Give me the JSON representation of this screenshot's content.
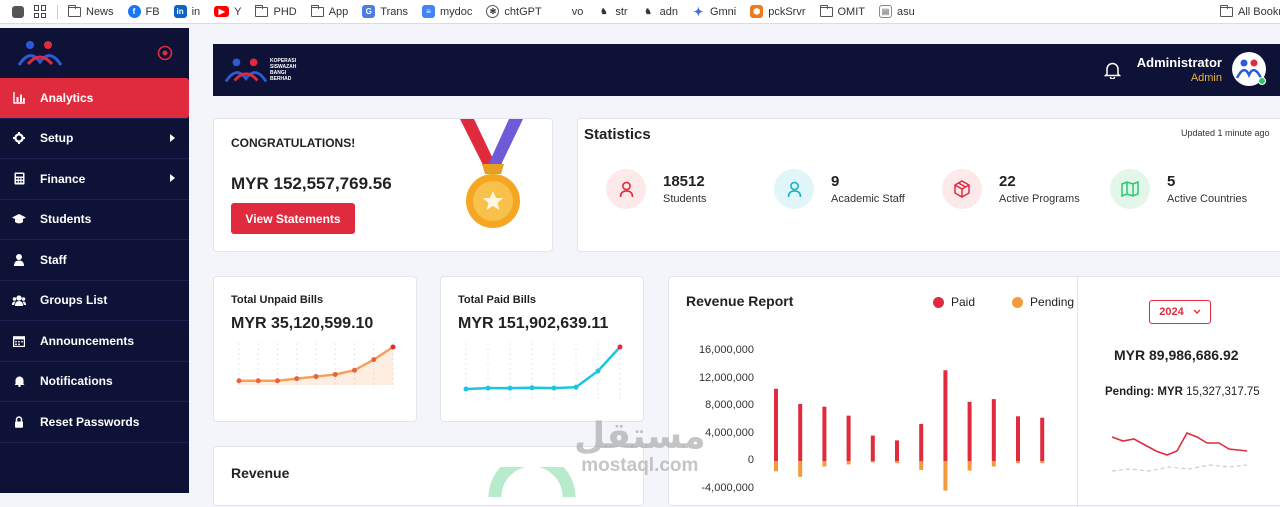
{
  "bookmarks": [
    "News",
    "FB",
    "in",
    "Y",
    "PHD",
    "App",
    "Trans",
    "mydoc",
    "chtGPT",
    "vo",
    "str",
    "adn",
    "Gmni",
    "pckSrvr",
    "OMIT",
    "asu",
    "All Bookm"
  ],
  "logo_text": [
    "KOPERASI",
    "SISWAZAH",
    "BANGI",
    "BERHAD"
  ],
  "sidebar": {
    "items": [
      {
        "label": "Analytics",
        "icon": "bar-chart-icon",
        "active": true
      },
      {
        "label": "Setup",
        "icon": "gear-icon",
        "arrow": true
      },
      {
        "label": "Finance",
        "icon": "calculator-icon",
        "arrow": true
      },
      {
        "label": "Students",
        "icon": "graduation-cap-icon"
      },
      {
        "label": "Staff",
        "icon": "person-icon"
      },
      {
        "label": "Groups List",
        "icon": "group-icon"
      },
      {
        "label": "Announcements",
        "icon": "calendar-icon"
      },
      {
        "label": "Notifications",
        "icon": "bell-icon"
      },
      {
        "label": "Reset Passwords",
        "icon": "lock-icon"
      }
    ]
  },
  "header": {
    "user_name": "Administrator",
    "user_role": "Admin"
  },
  "congrats": {
    "title": "CONGRATULATIONS!",
    "amount": "MYR 152,557,769.56",
    "button": "View Statements"
  },
  "statistics": {
    "title": "Statistics",
    "updated": "Updated 1 minute ago",
    "items": [
      {
        "value": "18512",
        "label": "Students",
        "icon": "user-icon",
        "color": "#e02b3e"
      },
      {
        "value": "9",
        "label": "Academic Staff",
        "icon": "user-icon",
        "color": "#12b5c8"
      },
      {
        "value": "22",
        "label": "Active Programs",
        "icon": "cube-icon",
        "color": "#e02b3e"
      },
      {
        "value": "5",
        "label": "Active Countries",
        "icon": "map-icon",
        "color": "#28c76f"
      }
    ]
  },
  "unpaid": {
    "title": "Total Unpaid Bills",
    "amount": "MYR 35,120,599.10",
    "spark": [
      2,
      2,
      2,
      3,
      4,
      5,
      7,
      12,
      18
    ]
  },
  "paid": {
    "title": "Total Paid Bills",
    "amount": "MYR 151,902,639.11",
    "spark": [
      2,
      2.3,
      2.3,
      2.4,
      2.3,
      2.6,
      8,
      16
    ]
  },
  "revenue_report": {
    "title": "Revenue Report",
    "legend": [
      {
        "name": "Paid",
        "color": "#e02b3e"
      },
      {
        "name": "Pending",
        "color": "#f39a3c"
      }
    ]
  },
  "chart_data": {
    "type": "bar",
    "yticks": [
      "16,000,000",
      "12,000,000",
      "8,000,000",
      "4,000,000",
      "0",
      "-4,000,000"
    ],
    "ylim": [
      -4000000,
      16000000
    ],
    "series": [
      {
        "name": "Paid",
        "values": [
          10500000,
          8300000,
          7900000,
          6600000,
          3700000,
          3000000,
          5400000,
          13200000,
          8600000,
          9000000,
          6500000,
          6300000
        ]
      },
      {
        "name": "Pending",
        "values": [
          -1500000,
          -2300000,
          -800000,
          -500000,
          -200000,
          -300000,
          -1300000,
          -4300000,
          -1400000,
          -800000,
          -300000,
          -300000
        ]
      }
    ]
  },
  "budget": {
    "year": "2024",
    "amount": "MYR 89,986,686.92",
    "pending_label": "Pending: MYR",
    "pending_value": "15,327,317.75"
  },
  "revenue_card": {
    "title": "Revenue"
  },
  "watermark": {
    "arabic": "مستقل",
    "latin": "mostaql.com"
  }
}
